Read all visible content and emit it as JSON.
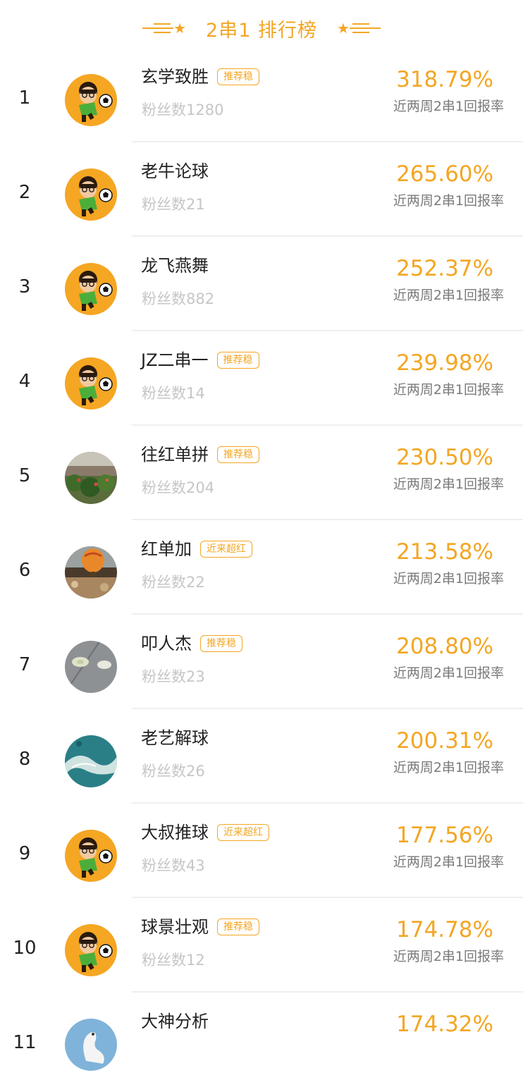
{
  "header": {
    "title": "2串1 排行榜"
  },
  "colors": {
    "accent": "#f3a623",
    "text": "#222222",
    "muted": "#c6c6c6",
    "label": "#7a7a7a"
  },
  "list": [
    {
      "rank": "1",
      "name": "玄学致胜",
      "tag": "推荐稳",
      "fans": "粉丝数1280",
      "rate": "318.79%",
      "rate_label": "近两周2串1回报率",
      "avatar": "soccer-kid"
    },
    {
      "rank": "2",
      "name": "老牛论球",
      "tag": "",
      "fans": "粉丝数21",
      "rate": "265.60%",
      "rate_label": "近两周2串1回报率",
      "avatar": "soccer-kid"
    },
    {
      "rank": "3",
      "name": "龙飞燕舞",
      "tag": "",
      "fans": "粉丝数882",
      "rate": "252.37%",
      "rate_label": "近两周2串1回报率",
      "avatar": "soccer-kid"
    },
    {
      "rank": "4",
      "name": "JZ二串一",
      "tag": "推荐稳",
      "fans": "粉丝数14",
      "rate": "239.98%",
      "rate_label": "近两周2串1回报率",
      "avatar": "soccer-kid"
    },
    {
      "rank": "5",
      "name": "往红单拼",
      "tag": "推荐稳",
      "fans": "粉丝数204",
      "rate": "230.50%",
      "rate_label": "近两周2串1回报率",
      "avatar": "garden-photo"
    },
    {
      "rank": "6",
      "name": "红单加",
      "tag": "近来超红",
      "fans": "粉丝数22",
      "rate": "213.58%",
      "rate_label": "近两周2串1回报率",
      "avatar": "balloon-photo"
    },
    {
      "rank": "7",
      "name": "叩人杰",
      "tag": "推荐稳",
      "fans": "粉丝数23",
      "rate": "208.80%",
      "rate_label": "近两周2串1回报率",
      "avatar": "stones-photo"
    },
    {
      "rank": "8",
      "name": "老艺解球",
      "tag": "",
      "fans": "粉丝数26",
      "rate": "200.31%",
      "rate_label": "近两周2串1回报率",
      "avatar": "sea-photo"
    },
    {
      "rank": "9",
      "name": "大叔推球",
      "tag": "近来超红",
      "fans": "粉丝数43",
      "rate": "177.56%",
      "rate_label": "近两周2串1回报率",
      "avatar": "soccer-kid"
    },
    {
      "rank": "10",
      "name": "球景壮观",
      "tag": "推荐稳",
      "fans": "粉丝数12",
      "rate": "174.78%",
      "rate_label": "近两周2串1回报率",
      "avatar": "soccer-kid"
    },
    {
      "rank": "11",
      "name": "大神分析",
      "tag": "",
      "fans": "",
      "rate": "174.32%",
      "rate_label": "",
      "avatar": "swan-photo"
    }
  ]
}
